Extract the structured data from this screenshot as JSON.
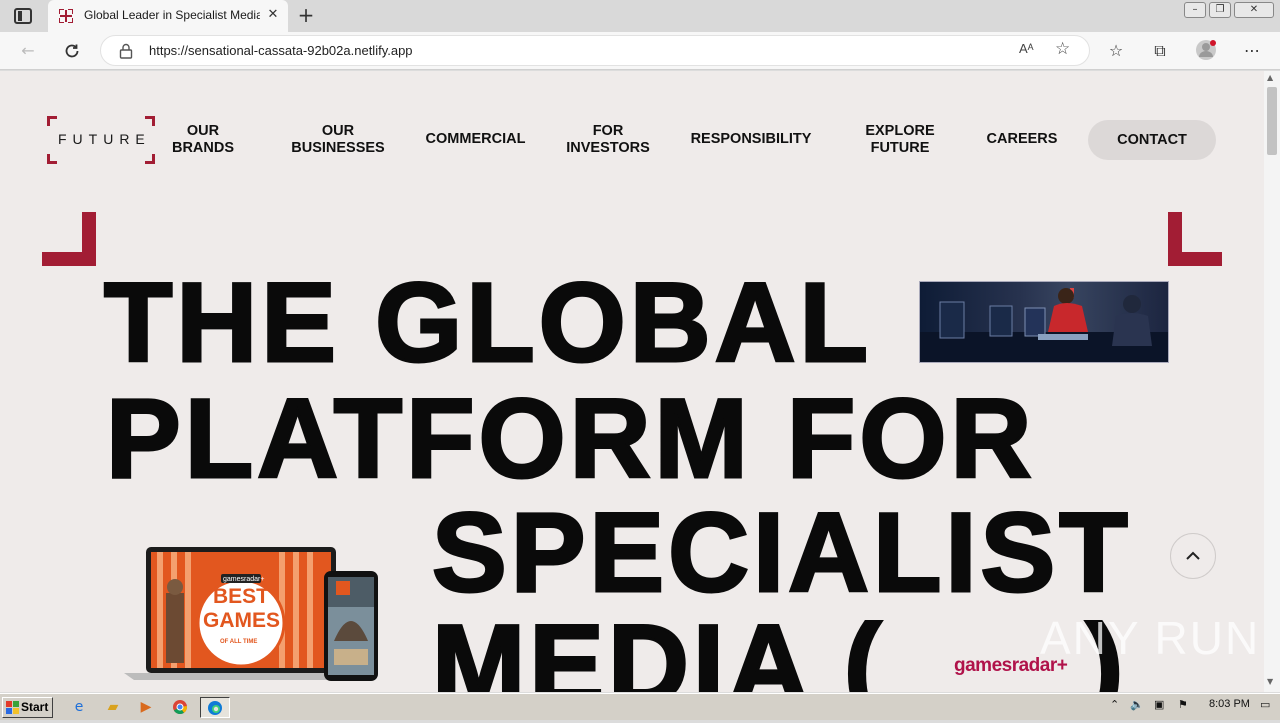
{
  "browser": {
    "tab_title": "Global Leader in Specialist Media",
    "tab_close": "✕",
    "new_tab": "+",
    "url": "https://sensational-cassata-92b02a.netlify.app",
    "read_aloud": "Aᴬ"
  },
  "site": {
    "logo_text": "FUTURE",
    "nav": [
      {
        "label": "OUR\nBRANDS"
      },
      {
        "label": "OUR\nBUSINESSES"
      },
      {
        "label": "COMMERCIAL"
      },
      {
        "label": "FOR\nINVESTORS"
      },
      {
        "label": "RESPONSIBILITY"
      },
      {
        "label": "EXPLORE\nFUTURE"
      },
      {
        "label": "CAREERS"
      }
    ],
    "contact": "CONTACT",
    "hero": {
      "line1": "THE GLOBAL",
      "line2": "PLATFORM FOR",
      "line3": "SPECIALIST",
      "line4_a": "MEDIA (",
      "line4_b": ")"
    },
    "promo": {
      "brand_small": "gamesradar+",
      "headline_1": "BEST",
      "headline_2": "GAMES",
      "sub": "OF ALL TIME"
    },
    "brand_logo": "gamesradar+",
    "brand_color": "#a21d34"
  },
  "watermark": "ANY RUN",
  "taskbar": {
    "start": "Start",
    "clock": "8:03 PM"
  }
}
